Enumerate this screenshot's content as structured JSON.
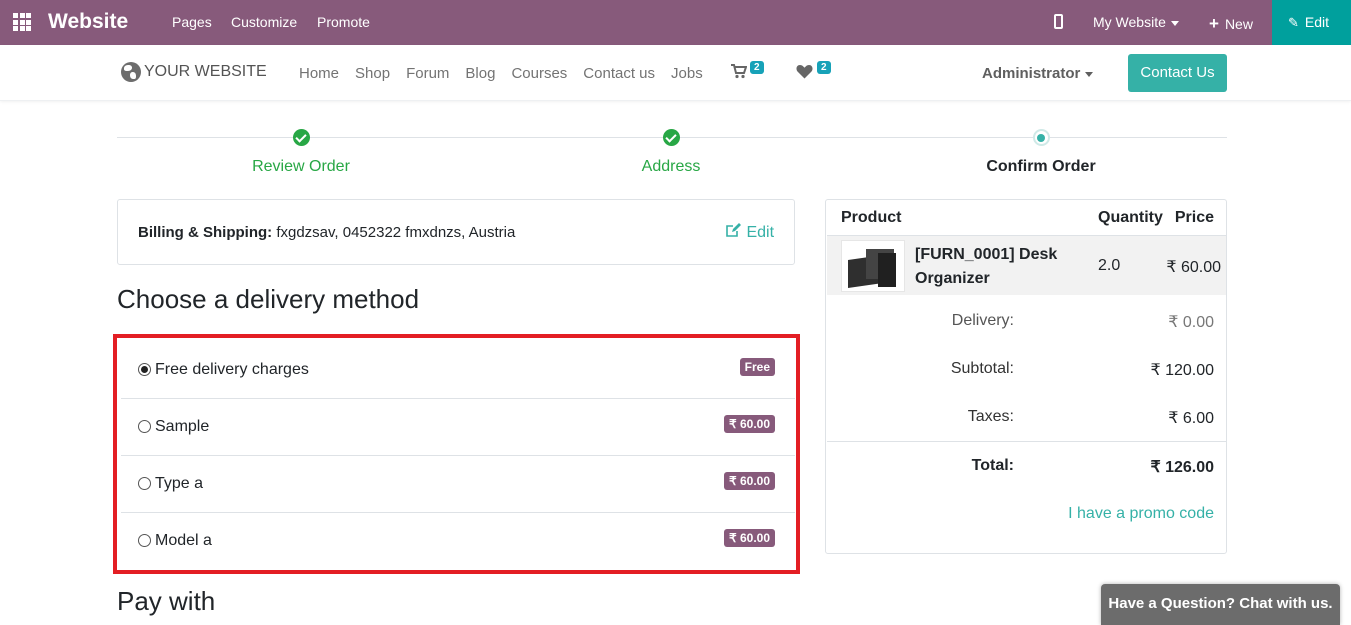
{
  "topbar": {
    "brand": "Website",
    "menus": [
      "Pages",
      "Customize",
      "Promote"
    ],
    "site_selector": "My Website",
    "new_label": "New",
    "edit_label": "Edit"
  },
  "navbar": {
    "logo_text": "YOUR WEBSITE",
    "links": [
      "Home",
      "Shop",
      "Forum",
      "Blog",
      "Courses",
      "Contact us",
      "Jobs"
    ],
    "cart_count": "2",
    "wishlist_count": "2",
    "user": "Administrator",
    "contact_button": "Contact Us"
  },
  "steps": [
    {
      "label": "Review Order",
      "state": "done"
    },
    {
      "label": "Address",
      "state": "done"
    },
    {
      "label": "Confirm Order",
      "state": "current"
    }
  ],
  "billing": {
    "label": "Billing & Shipping:",
    "value": "fxgdzsav, 0452322 fmxdnzs, Austria",
    "edit_label": "Edit"
  },
  "delivery": {
    "heading": "Choose a delivery method",
    "methods": [
      {
        "name": "Free delivery charges",
        "price": "Free",
        "selected": true
      },
      {
        "name": "Sample",
        "price": "₹ 60.00",
        "selected": false
      },
      {
        "name": "Type a",
        "price": "₹ 60.00",
        "selected": false
      },
      {
        "name": "Model a",
        "price": "₹ 60.00",
        "selected": false
      }
    ]
  },
  "pay_heading": "Pay with",
  "summary": {
    "headers": {
      "product": "Product",
      "quantity": "Quantity",
      "price": "Price"
    },
    "item": {
      "name": "[FURN_0001] Desk Organizer",
      "quantity": "2.0",
      "price": "₹ 60.00"
    },
    "delivery_label": "Delivery:",
    "delivery_value": "₹ 0.00",
    "subtotal_label": "Subtotal:",
    "subtotal_value": "₹ 120.00",
    "taxes_label": "Taxes:",
    "taxes_value": "₹ 6.00",
    "total_label": "Total:",
    "total_value": "₹ 126.00",
    "promo_link": "I have a promo code"
  },
  "chat_label": "Have a Question? Chat with us.",
  "colors": {
    "brand": "#875a7b",
    "accent": "#35b1a7",
    "success": "#28a745",
    "highlight_border": "#e31e24"
  }
}
